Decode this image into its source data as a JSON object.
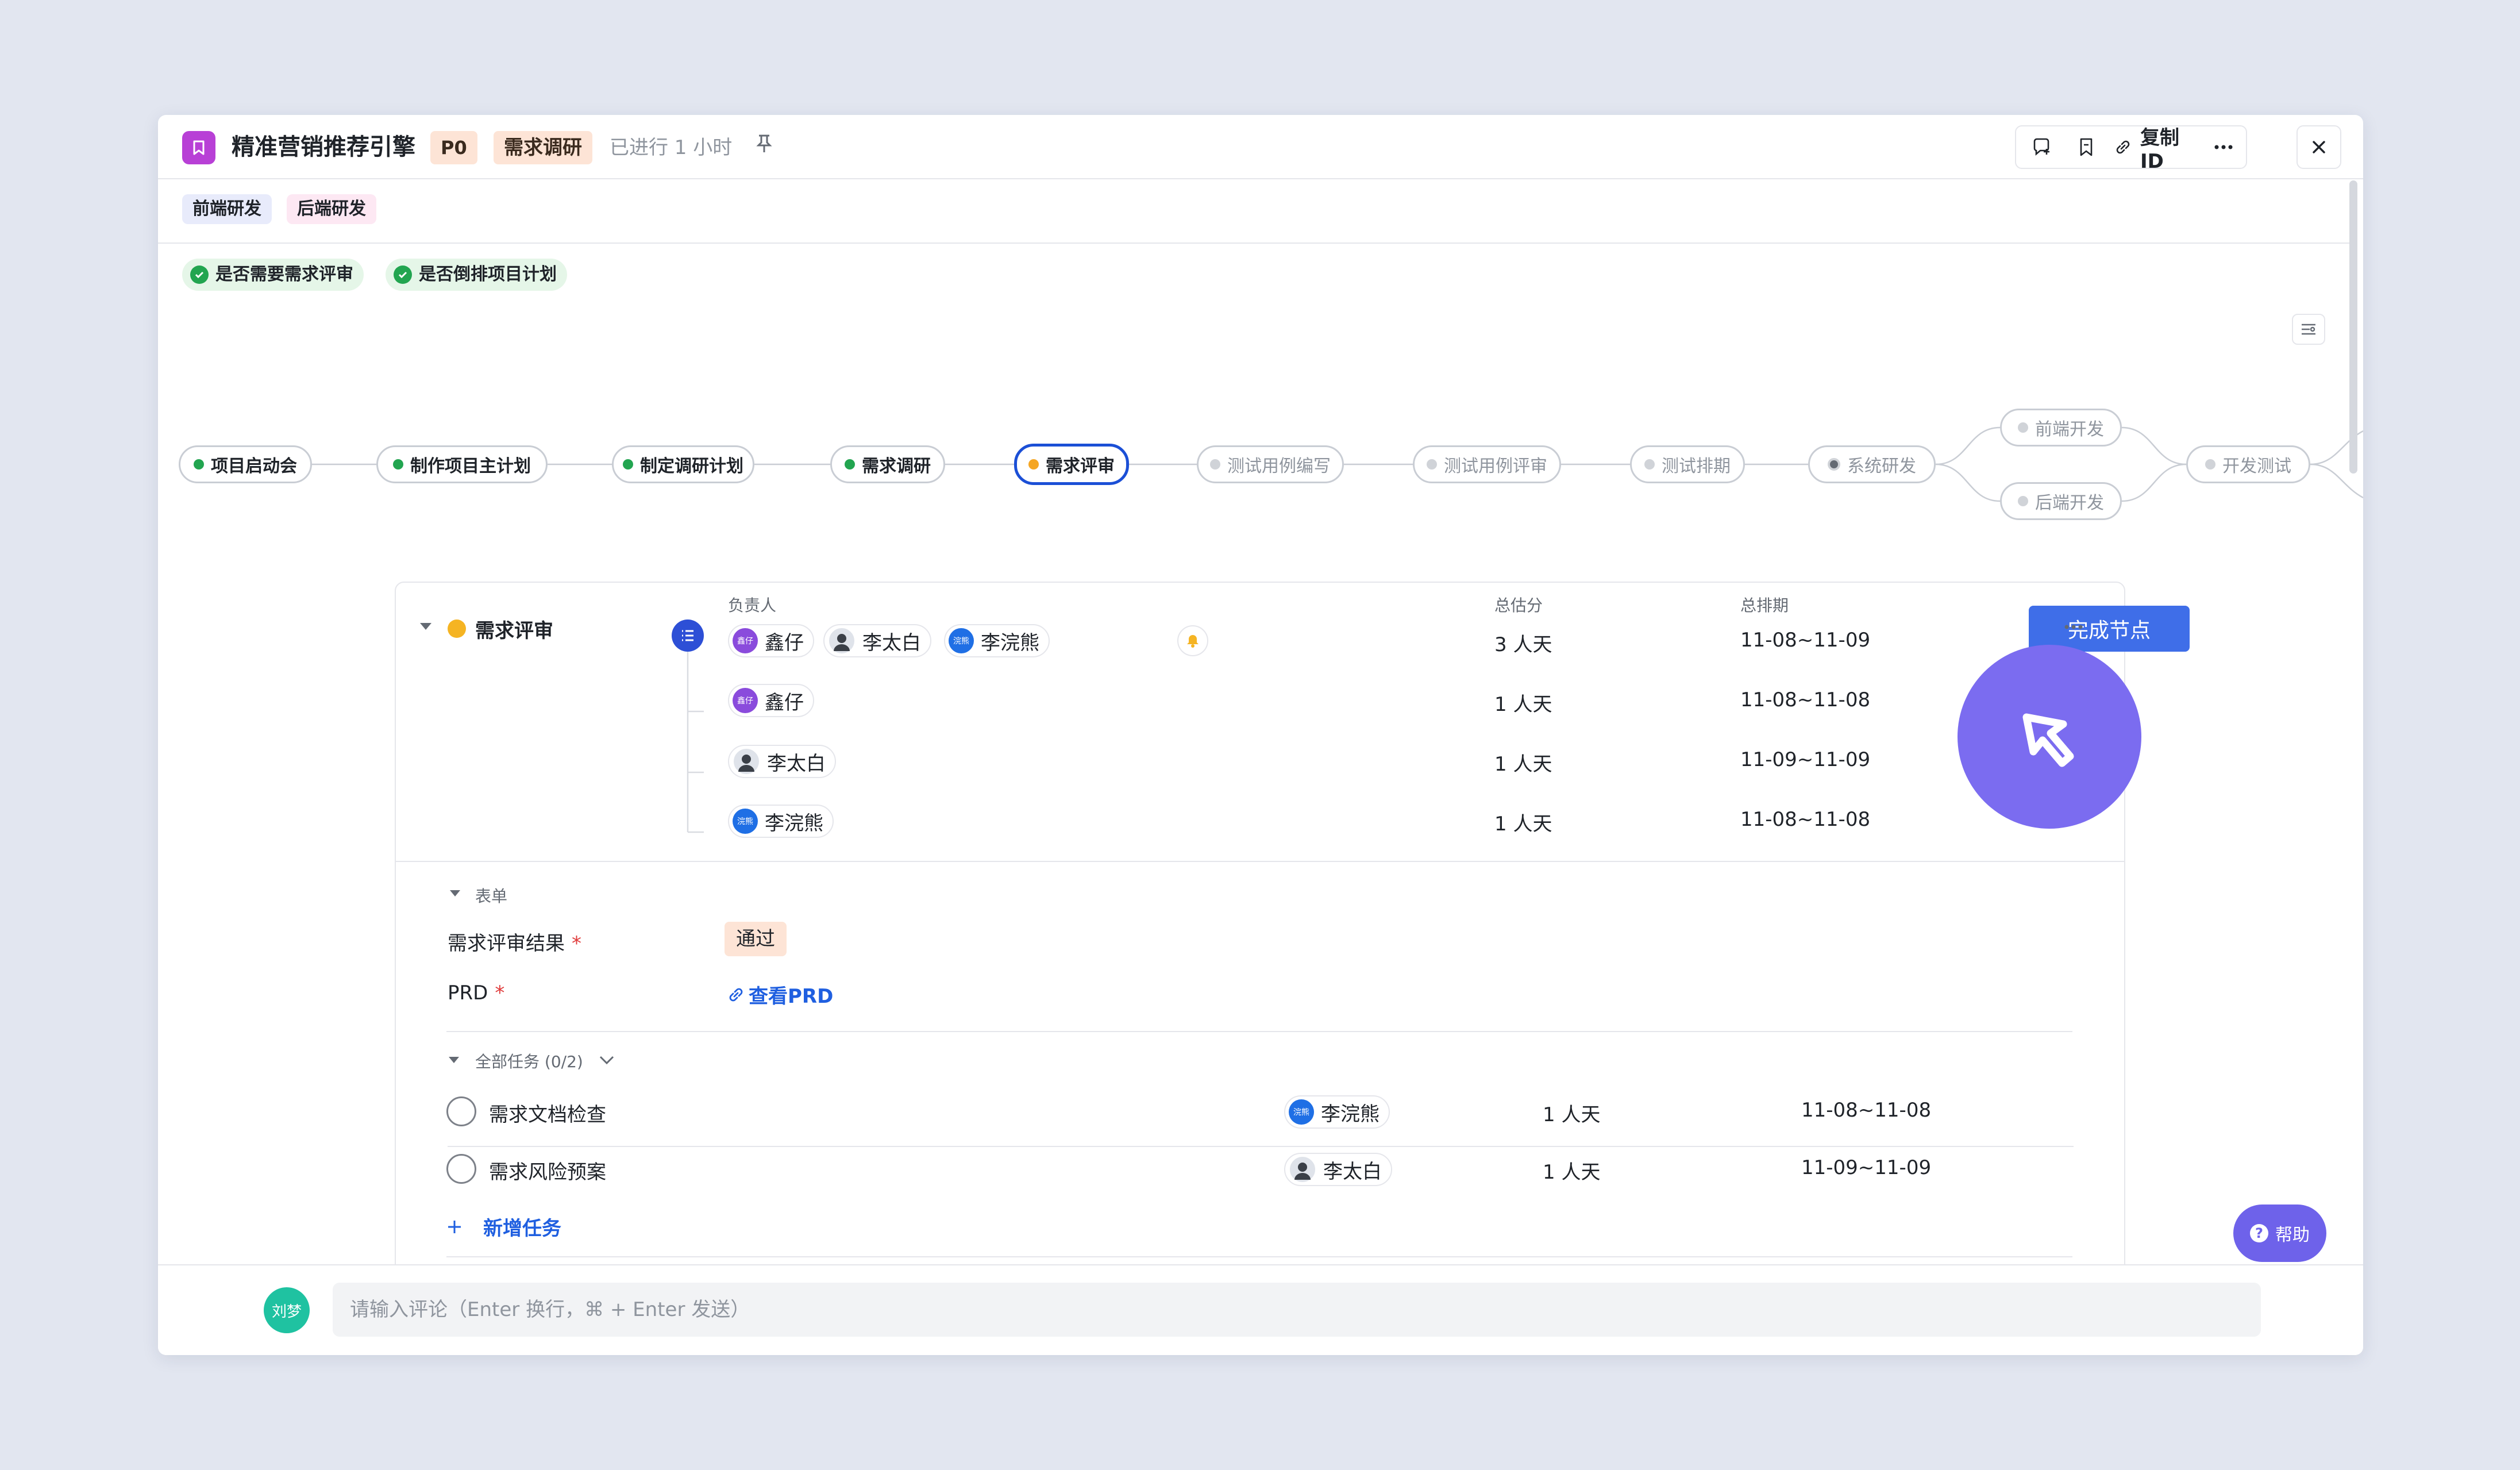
{
  "header": {
    "title": "精准营销推荐引擎",
    "priority": "P0",
    "stage": "需求调研",
    "elapsed": "已进行 1 小时",
    "copy_id_label": "复制ID"
  },
  "departments": [
    "前端研发",
    "后端研发"
  ],
  "checks": [
    "是否需要需求评审",
    "是否倒排项目计划"
  ],
  "flow": {
    "nodes": [
      {
        "label": "项目启动会",
        "state": "done"
      },
      {
        "label": "制作项目主计划",
        "state": "done"
      },
      {
        "label": "制定调研计划",
        "state": "done"
      },
      {
        "label": "需求调研",
        "state": "done"
      },
      {
        "label": "需求评审",
        "state": "current"
      },
      {
        "label": "测试用例编写",
        "state": "todo"
      },
      {
        "label": "测试用例评审",
        "state": "todo"
      },
      {
        "label": "测试排期",
        "state": "todo"
      },
      {
        "label": "系统研发",
        "state": "in-progress"
      },
      {
        "label": "前端开发",
        "state": "todo"
      },
      {
        "label": "后端开发",
        "state": "todo"
      },
      {
        "label": "开发测试",
        "state": "todo"
      }
    ]
  },
  "node_detail": {
    "name": "需求评审",
    "col_owner": "负责人",
    "col_estimate": "总估分",
    "col_schedule": "总排期",
    "summary": {
      "owners": [
        {
          "name": "鑫仔",
          "avatar_text": "鑫仔"
        },
        {
          "name": "李太白",
          "avatar_text": ""
        },
        {
          "name": "李浣熊",
          "avatar_text": "浣熊"
        }
      ],
      "estimate": "3 人天",
      "schedule": "11-08~11-09"
    },
    "rows": [
      {
        "owner": "鑫仔",
        "avatar_text": "鑫仔",
        "estimate": "1 人天",
        "schedule": "11-08~11-08"
      },
      {
        "owner": "李太白",
        "avatar_text": "",
        "estimate": "1 人天",
        "schedule": "11-09~11-09"
      },
      {
        "owner": "李浣熊",
        "avatar_text": "浣熊",
        "estimate": "1 人天",
        "schedule": "11-08~11-08"
      }
    ],
    "complete_button": "完成节点"
  },
  "form": {
    "section_label": "表单",
    "fields": [
      {
        "label": "需求评审结果",
        "value": "通过"
      },
      {
        "label": "PRD",
        "value": "查看PRD"
      }
    ]
  },
  "tasks": {
    "section_label": "全部任务 (0/2)",
    "items": [
      {
        "name": "需求文档检查",
        "owner": "李浣熊",
        "avatar_text": "浣熊",
        "estimate": "1 人天",
        "schedule": "11-08~11-08"
      },
      {
        "name": "需求风险预案",
        "owner": "李太白",
        "avatar_text": "",
        "estimate": "1 人天",
        "schedule": "11-09~11-09"
      }
    ],
    "add_label": "新增任务"
  },
  "help_label": "帮助",
  "comment": {
    "avatar_text": "刘梦",
    "placeholder": "请输入评论（Enter 换行，⌘ + Enter 发送）"
  },
  "colors": {
    "accent": "#3f6ee8",
    "done": "#22a550",
    "current": "#f5a623",
    "cursor": "#7b6cf0"
  }
}
